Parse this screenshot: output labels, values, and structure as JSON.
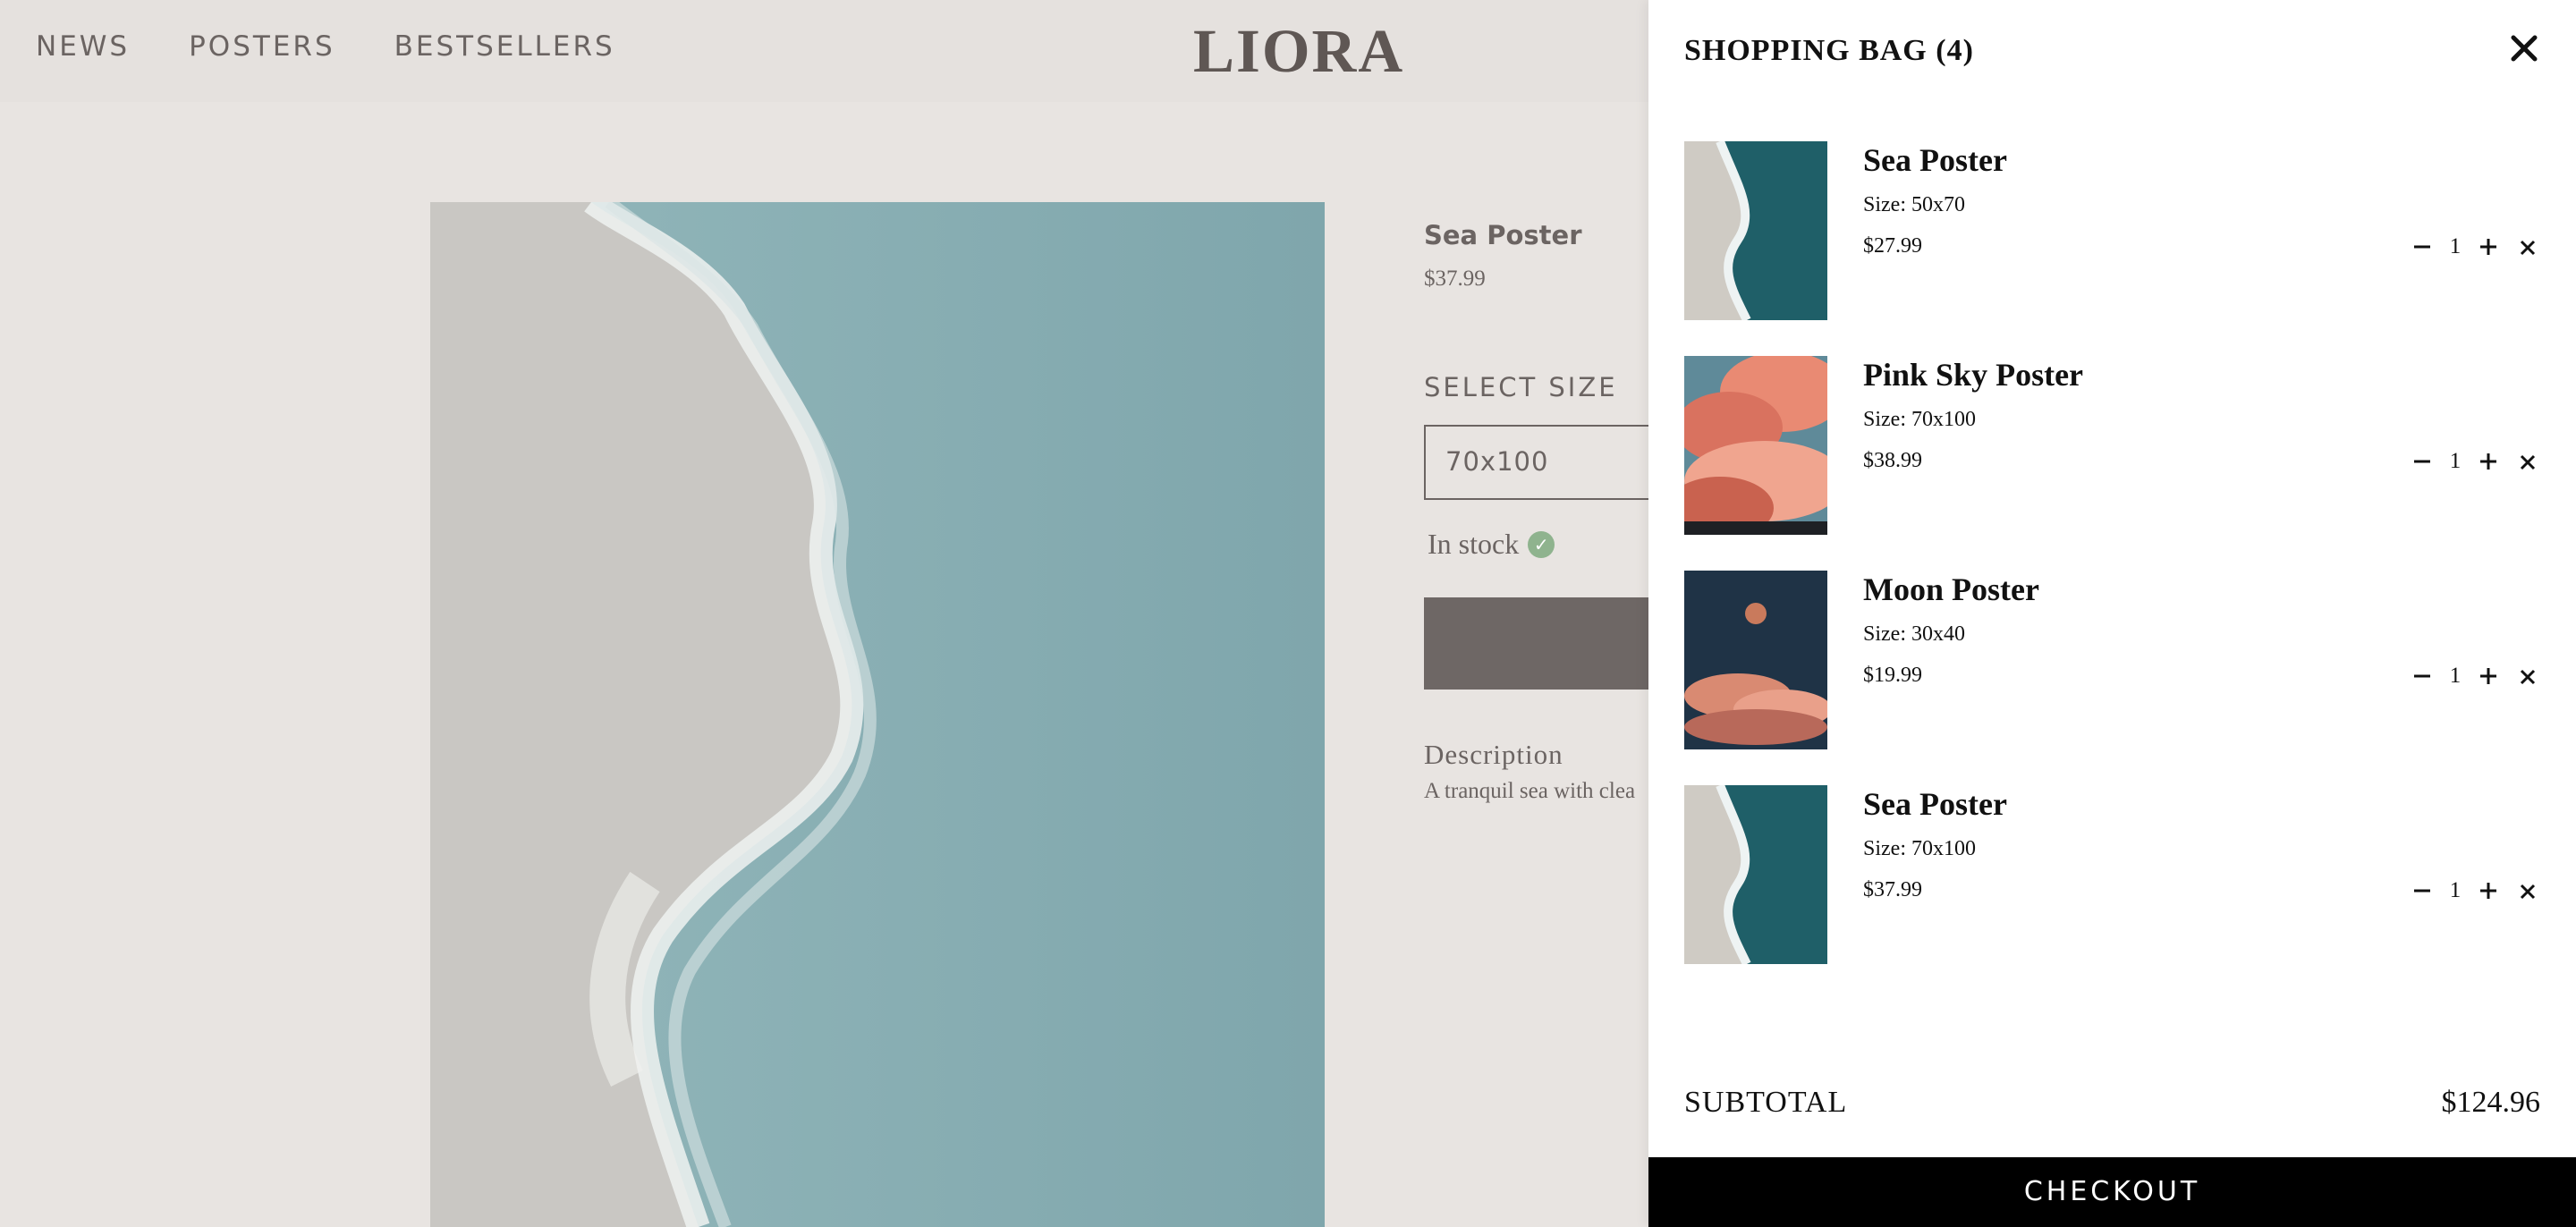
{
  "nav": {
    "items": [
      "NEWS",
      "POSTERS",
      "BESTSELLERS"
    ]
  },
  "brand": {
    "logo": "LIORA"
  },
  "product": {
    "name": "Sea Poster",
    "price": "$37.99",
    "size_label": "SELECT SIZE",
    "selected_size": "70x100",
    "stock": "In stock",
    "description_title": "Description",
    "description_text": "A tranquil sea with clea"
  },
  "cart": {
    "title": "SHOPPING BAG (4)",
    "items": [
      {
        "name": "Sea Poster",
        "size": "Size: 50x70",
        "price": "$27.99",
        "qty": "1",
        "thumb": "sea-thumbnail"
      },
      {
        "name": "Pink Sky Poster",
        "size": "Size: 70x100",
        "price": "$38.99",
        "qty": "1",
        "thumb": "pink-sky-thumbnail"
      },
      {
        "name": "Moon Poster",
        "size": "Size: 30x40",
        "price": "$19.99",
        "qty": "1",
        "thumb": "moon-thumbnail"
      },
      {
        "name": "Sea Poster",
        "size": "Size: 70x100",
        "price": "$37.99",
        "qty": "1",
        "thumb": "sea-thumbnail"
      }
    ],
    "subtotal_label": "SUBTOTAL",
    "subtotal_value": "$124.96",
    "checkout_label": "CHECKOUT"
  },
  "colors": {
    "page_bg": "#e8e4e1",
    "text_muted": "#6b6462",
    "drawer_bg": "#ffffff",
    "checkout_bg": "#000000",
    "stock_green": "#8fb38e"
  },
  "icons": [
    "close-icon",
    "minus-icon",
    "plus-icon",
    "remove-icon",
    "check-icon"
  ]
}
